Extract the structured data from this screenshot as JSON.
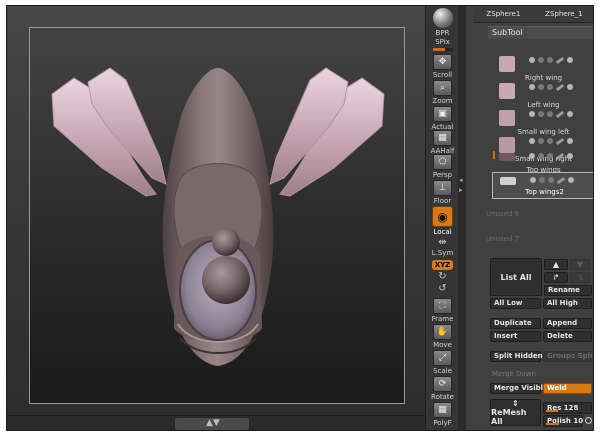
{
  "shelf": {
    "items": [
      {
        "name": "bpr",
        "label": "BPR"
      },
      {
        "name": "spix",
        "label": "SPix"
      },
      {
        "name": "scroll",
        "label": "Scroll"
      },
      {
        "name": "zoom",
        "label": "Zoom"
      },
      {
        "name": "actual",
        "label": "Actual"
      },
      {
        "name": "aahalf",
        "label": "AAHalf"
      },
      {
        "name": "persp",
        "label": "Persp"
      },
      {
        "name": "floor",
        "label": "Floor"
      },
      {
        "name": "local",
        "label": "Local"
      },
      {
        "name": "lsym",
        "label": "L.Sym"
      },
      {
        "name": "xyz",
        "label": "XYZ"
      },
      {
        "name": "frame",
        "label": "Frame"
      },
      {
        "name": "move",
        "label": "Move"
      },
      {
        "name": "scale",
        "label": "Scale"
      },
      {
        "name": "rotate",
        "label": "Rotate"
      },
      {
        "name": "polyf",
        "label": "PolyF"
      }
    ],
    "spix_level": 0.6
  },
  "tool_tabs": [
    "ZSphere1",
    "ZSphere_1"
  ],
  "subtool": {
    "title": "SubTool",
    "items": [
      {
        "name": "Right wing",
        "thumb_color": "#c9a8b4"
      },
      {
        "name": "Left wing",
        "thumb_color": "#c9a8b4"
      },
      {
        "name": "Small wing left",
        "thumb_color": "#c0a0ad"
      },
      {
        "name": "Small wing right",
        "thumb_color": "#b89aa6"
      },
      {
        "name": "Top wings",
        "thumb_color": "#6e5a60"
      },
      {
        "name": "Top wings2",
        "thumb_color": "#cfcfcf",
        "selected": true
      }
    ],
    "unused": [
      "Unused 6",
      "Unused 7"
    ]
  },
  "buttons": {
    "list_all": "List All",
    "rename": "Rename",
    "all_low": "All Low",
    "all_high": "All High",
    "duplicate": "Duplicate",
    "append": "Append",
    "insert": "Insert",
    "delete": "Delete",
    "split_hidden": "Split Hidden",
    "groups_split": "Groups Split",
    "merge_down": "Merge Down",
    "merge_visible": "Merge Visible",
    "weld": "Weld",
    "remesh_all": "ReMesh All"
  },
  "sliders": {
    "res": {
      "label": "Res",
      "value": "128",
      "level": 0.25
    },
    "polish": {
      "label": "Polish",
      "value": "10",
      "level": 0.35
    }
  },
  "colors": {
    "accent": "#d97a12",
    "model": "#7d6a6c",
    "wing": "#c8a9b6"
  }
}
